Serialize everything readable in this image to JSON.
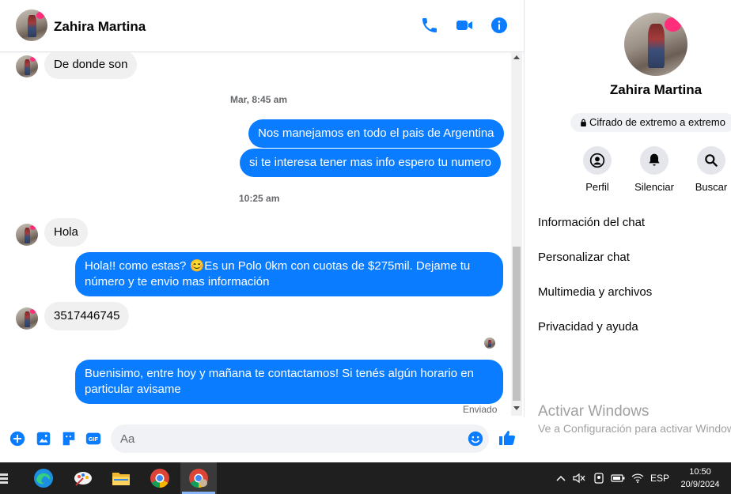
{
  "contact": {
    "name": "Zahira Martina"
  },
  "messages": [
    {
      "dir": "in",
      "text": "De donde son"
    },
    {
      "dir": "time",
      "text": "Mar, 8:45 am"
    },
    {
      "dir": "out",
      "text": "Nos manejamos en todo el pais de Argentina"
    },
    {
      "dir": "out",
      "text": "si te interesa tener mas info espero tu numero"
    },
    {
      "dir": "time",
      "text": "10:25 am"
    },
    {
      "dir": "in",
      "text": "Hola"
    },
    {
      "dir": "out",
      "text": "Hola!! como estas? 😊Es un Polo 0km con cuotas de $275mil. Dejame tu número y te envio mas información"
    },
    {
      "dir": "in",
      "text": "3517446745"
    },
    {
      "dir": "out",
      "text": "Buenisimo, entre hoy y mañana te contactamos! Si tenés algún horario en particular avisame"
    }
  ],
  "status": {
    "sent": "Enviado"
  },
  "composer": {
    "placeholder": "Aa"
  },
  "info": {
    "encryption": "Cifrado de extremo a extremo",
    "actions": [
      "Perfil",
      "Silenciar",
      "Buscar"
    ],
    "items": [
      "Información del chat",
      "Personalizar chat",
      "Multimedia y archivos",
      "Privacidad y ayuda"
    ]
  },
  "watermark": {
    "title": "Activar Windows",
    "subtitle": "Ve a Configuración para activar Windows."
  },
  "taskbar": {
    "language": "ESP",
    "time": "10:50",
    "date": "20/9/2024"
  },
  "colors": {
    "accent": "#0a7cff",
    "bubble_in": "#f0f0f0",
    "header_icon": "#0a7cff"
  },
  "icons": [
    "phone-icon",
    "video-icon",
    "info-icon",
    "plus-icon",
    "image-icon",
    "sticker-icon",
    "gif-icon",
    "emoji-icon",
    "like-icon",
    "lock-icon",
    "user-icon",
    "bell-icon",
    "search-icon"
  ]
}
